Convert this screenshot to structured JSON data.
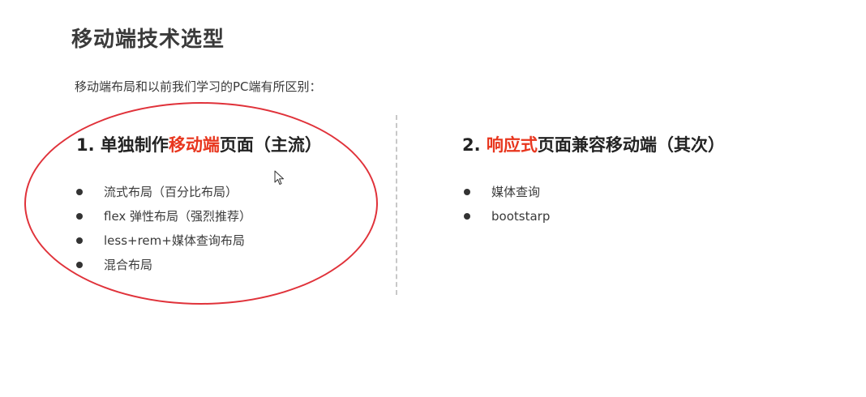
{
  "slide": {
    "title": "移动端技术选型",
    "subtitle": "移动端布局和以前我们学习的PC端有所区别：",
    "left": {
      "heading_prefix": "1. 单独制作",
      "heading_highlight": "移动端",
      "heading_suffix": "页面（主流）",
      "items": [
        "流式布局（百分比布局）",
        "flex 弹性布局（强烈推荐）",
        "less+rem+媒体查询布局",
        "混合布局"
      ]
    },
    "right": {
      "heading_prefix": "2. ",
      "heading_highlight": "响应式",
      "heading_suffix": "页面兼容移动端（其次）",
      "items": [
        "媒体查询",
        "bootstarp"
      ]
    }
  },
  "colors": {
    "highlight": "#e8361e",
    "ellipse": "#e0323a"
  },
  "icons": {
    "cursor": "mouse-pointer-icon",
    "bullet": "bullet-dot-icon"
  }
}
